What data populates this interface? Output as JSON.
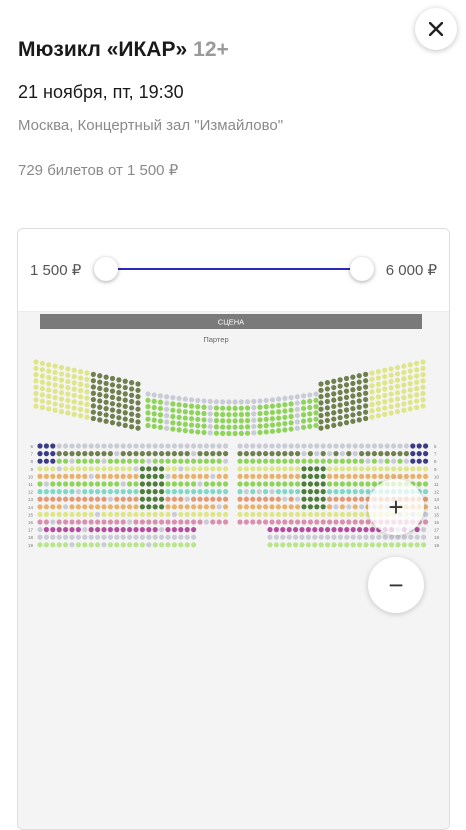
{
  "event": {
    "title": "Мюзикл «ИКАР»",
    "age": "12+",
    "date": "21 ноября, пт, 19:30",
    "venue": "Москва, Концертный зал \"Измайлово\"",
    "tickets_summary": "729 билетов от 1 500 ₽"
  },
  "price_filter": {
    "min_label": "1 500 ₽",
    "max_label": "6 000 ₽",
    "min_fraction": 0,
    "max_fraction": 1,
    "track_color": "#2b2bb8"
  },
  "seat_map": {
    "stage_label": "СЦЕНА",
    "section_label": "Партер",
    "stage_color": "#7a7a7a",
    "row_numbers": [
      "6",
      "7",
      "8",
      "9",
      "10",
      "11",
      "12",
      "13",
      "14",
      "15",
      "16",
      "17",
      "18",
      "19"
    ],
    "seat_colors": {
      "unavailable": "#c9ccd6",
      "yellow": "#dfe68a",
      "green": "#8ed35a",
      "olive": "#6f7f4e",
      "dark_green": "#4d7d3a",
      "peach": "#e8b26d",
      "salmon": "#e39a74",
      "pink": "#d98fb0",
      "magenta": "#b44fa0",
      "teal": "#7fd8c8",
      "navy": "#3b3b86",
      "light_green": "#b8e58c"
    }
  },
  "controls": {
    "close_icon": "close-icon",
    "zoom_in_label": "+",
    "zoom_out_label": "−"
  }
}
